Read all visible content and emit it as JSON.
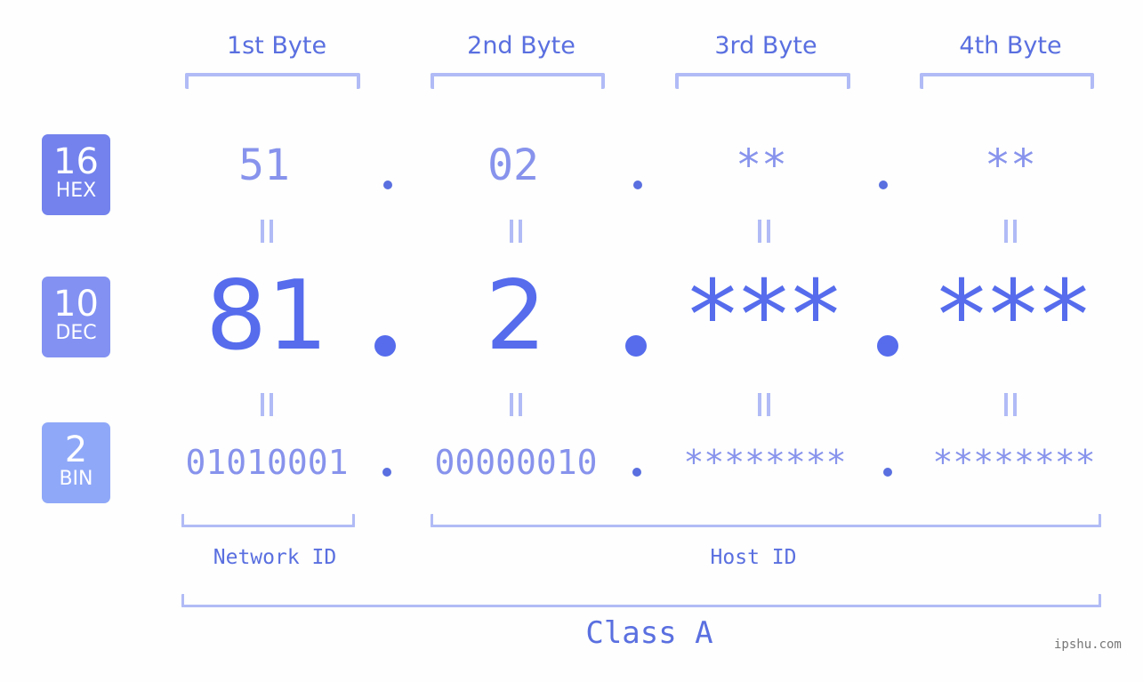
{
  "byte_headers": [
    "1st Byte",
    "2nd Byte",
    "3rd Byte",
    "4th Byte"
  ],
  "badges": [
    {
      "num": "16",
      "label": "HEX",
      "color": "#7382ec"
    },
    {
      "num": "10",
      "label": "DEC",
      "color": "#8291f2"
    },
    {
      "num": "2",
      "label": "BIN",
      "color": "#8fa8f8"
    }
  ],
  "hex": [
    "51",
    "02",
    "**",
    "**"
  ],
  "dec": [
    "81",
    "2",
    "***",
    "***"
  ],
  "bin": [
    "01010001",
    "00000010",
    "********",
    "********"
  ],
  "separator": ".",
  "equals": "=",
  "network_label": "Network ID",
  "host_label": "Host ID",
  "class_label": "Class A",
  "watermark": "ipshu.com"
}
